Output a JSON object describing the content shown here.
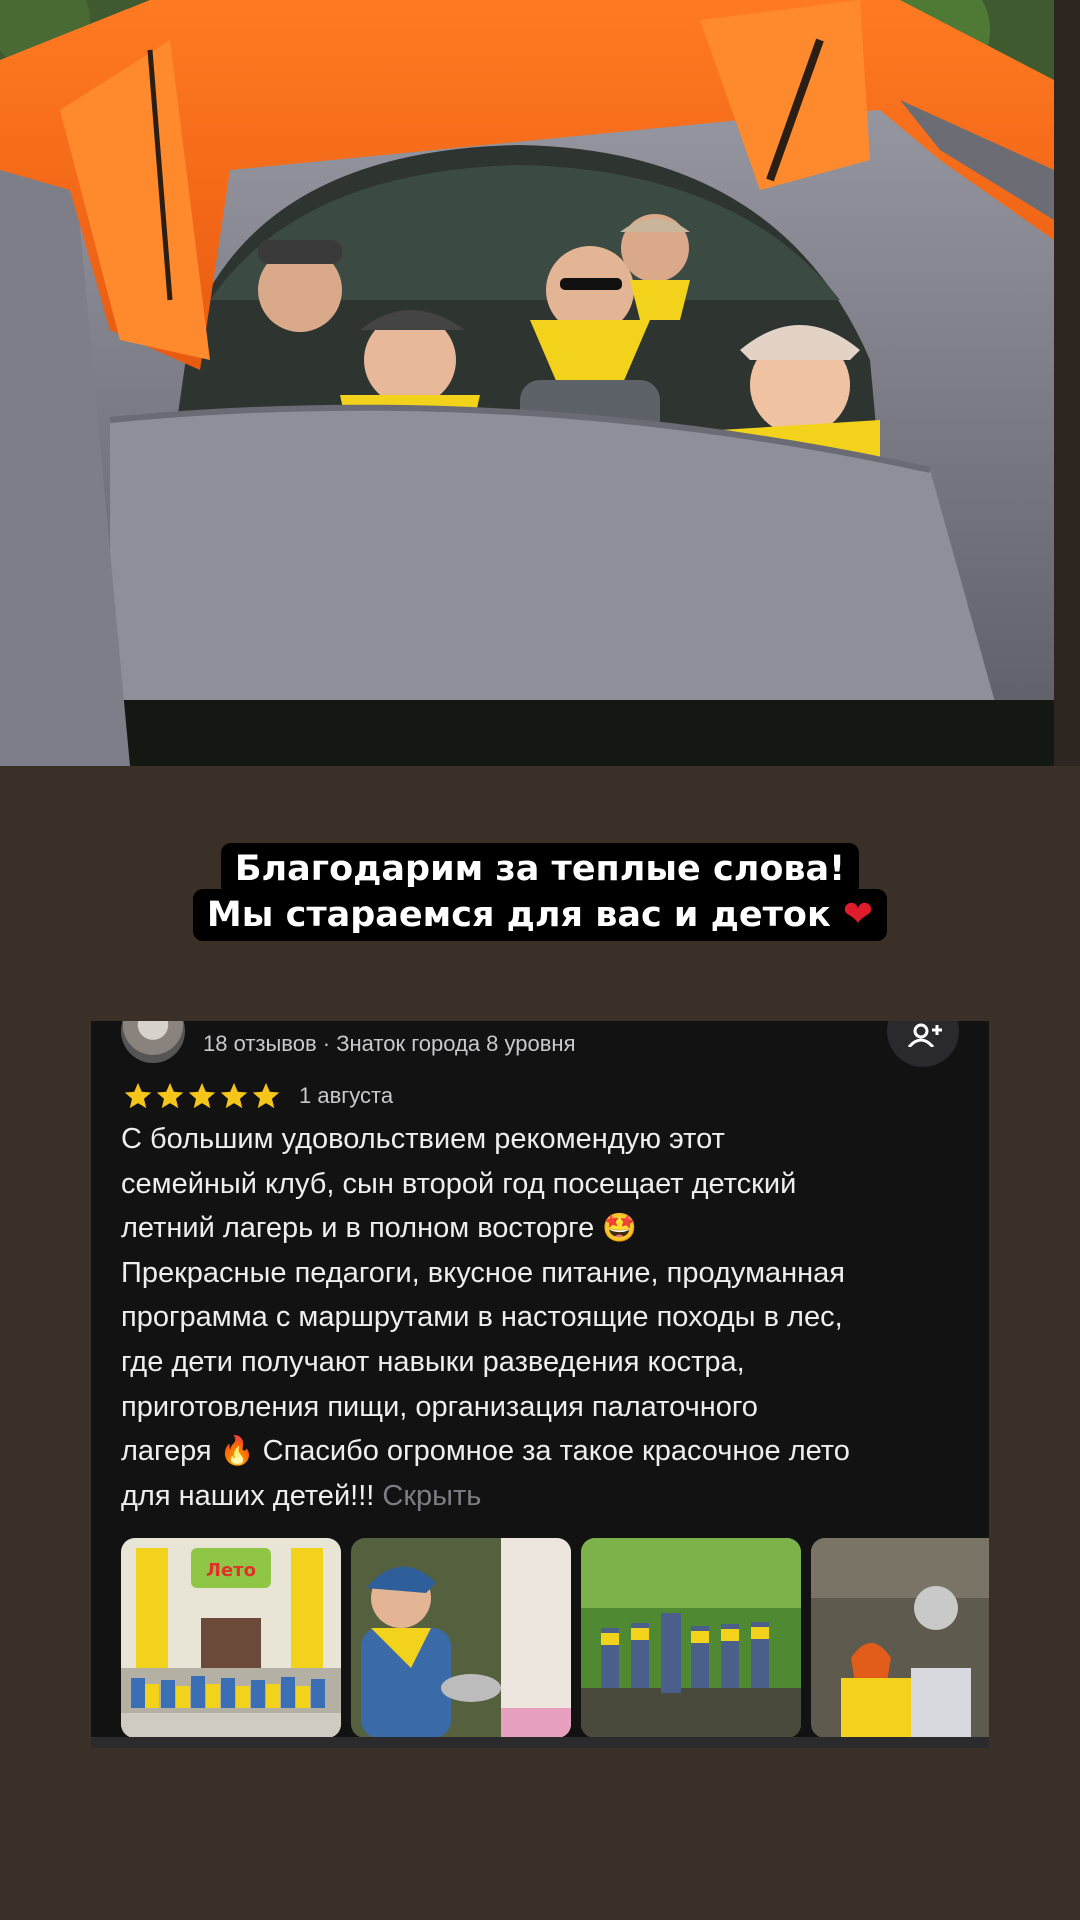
{
  "caption": {
    "line1": "Благодарим за теплые слова!",
    "line2": "Мы стараемся для вас и деток",
    "heart_icon": "heart-icon"
  },
  "review": {
    "meta": "18 отзывов · Знаток города 8 уровня",
    "rating": 5,
    "date": "1 августа",
    "paragraph1": "С большим удовольствием рекомендую этот\nсемейный клуб, сын второй год посещает детский\nлетний лагерь и в полном восторге",
    "paragraph2": "Прекрасные педагоги, вкусное питание, продуманная\nпрограмма с маршрутами в настоящие походы в лес,\nгде дети получают навыки разведения костра,\nприготовления пищи, организация палаточного\nлагеря",
    "paragraph3": "Спасибо огромное за такое красочное лето\nдля наших детей!!!",
    "hide_label": "Скрыть",
    "emoji_1": "🤩",
    "emoji_2": "🔥"
  },
  "photo_sign_text": "Лето",
  "colors": {
    "background": "#3b3028",
    "card": "#121213",
    "star": "#f5c518",
    "tent_orange": "#ff6a1a",
    "tent_gray": "#8c8c96",
    "scarf_yellow": "#f2d21a"
  }
}
